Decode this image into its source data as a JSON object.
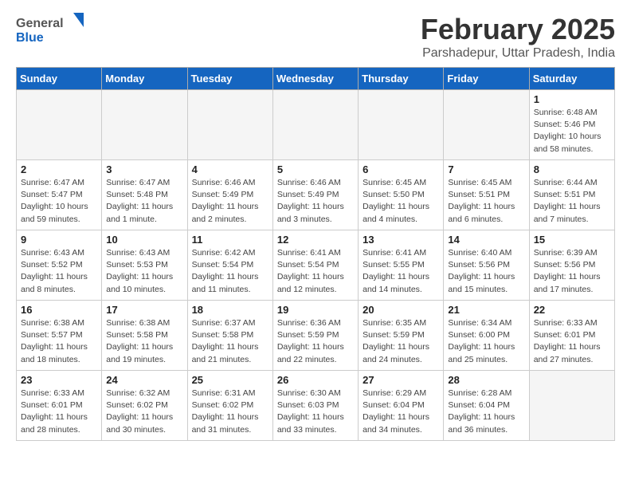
{
  "header": {
    "logo_general": "General",
    "logo_blue": "Blue",
    "title": "February 2025",
    "location": "Parshadepur, Uttar Pradesh, India"
  },
  "weekdays": [
    "Sunday",
    "Monday",
    "Tuesday",
    "Wednesday",
    "Thursday",
    "Friday",
    "Saturday"
  ],
  "weeks": [
    [
      {
        "day": "",
        "info": ""
      },
      {
        "day": "",
        "info": ""
      },
      {
        "day": "",
        "info": ""
      },
      {
        "day": "",
        "info": ""
      },
      {
        "day": "",
        "info": ""
      },
      {
        "day": "",
        "info": ""
      },
      {
        "day": "1",
        "info": "Sunrise: 6:48 AM\nSunset: 5:46 PM\nDaylight: 10 hours and 58 minutes."
      }
    ],
    [
      {
        "day": "2",
        "info": "Sunrise: 6:47 AM\nSunset: 5:47 PM\nDaylight: 10 hours and 59 minutes."
      },
      {
        "day": "3",
        "info": "Sunrise: 6:47 AM\nSunset: 5:48 PM\nDaylight: 11 hours and 1 minute."
      },
      {
        "day": "4",
        "info": "Sunrise: 6:46 AM\nSunset: 5:49 PM\nDaylight: 11 hours and 2 minutes."
      },
      {
        "day": "5",
        "info": "Sunrise: 6:46 AM\nSunset: 5:49 PM\nDaylight: 11 hours and 3 minutes."
      },
      {
        "day": "6",
        "info": "Sunrise: 6:45 AM\nSunset: 5:50 PM\nDaylight: 11 hours and 4 minutes."
      },
      {
        "day": "7",
        "info": "Sunrise: 6:45 AM\nSunset: 5:51 PM\nDaylight: 11 hours and 6 minutes."
      },
      {
        "day": "8",
        "info": "Sunrise: 6:44 AM\nSunset: 5:51 PM\nDaylight: 11 hours and 7 minutes."
      }
    ],
    [
      {
        "day": "9",
        "info": "Sunrise: 6:43 AM\nSunset: 5:52 PM\nDaylight: 11 hours and 8 minutes."
      },
      {
        "day": "10",
        "info": "Sunrise: 6:43 AM\nSunset: 5:53 PM\nDaylight: 11 hours and 10 minutes."
      },
      {
        "day": "11",
        "info": "Sunrise: 6:42 AM\nSunset: 5:54 PM\nDaylight: 11 hours and 11 minutes."
      },
      {
        "day": "12",
        "info": "Sunrise: 6:41 AM\nSunset: 5:54 PM\nDaylight: 11 hours and 12 minutes."
      },
      {
        "day": "13",
        "info": "Sunrise: 6:41 AM\nSunset: 5:55 PM\nDaylight: 11 hours and 14 minutes."
      },
      {
        "day": "14",
        "info": "Sunrise: 6:40 AM\nSunset: 5:56 PM\nDaylight: 11 hours and 15 minutes."
      },
      {
        "day": "15",
        "info": "Sunrise: 6:39 AM\nSunset: 5:56 PM\nDaylight: 11 hours and 17 minutes."
      }
    ],
    [
      {
        "day": "16",
        "info": "Sunrise: 6:38 AM\nSunset: 5:57 PM\nDaylight: 11 hours and 18 minutes."
      },
      {
        "day": "17",
        "info": "Sunrise: 6:38 AM\nSunset: 5:58 PM\nDaylight: 11 hours and 19 minutes."
      },
      {
        "day": "18",
        "info": "Sunrise: 6:37 AM\nSunset: 5:58 PM\nDaylight: 11 hours and 21 minutes."
      },
      {
        "day": "19",
        "info": "Sunrise: 6:36 AM\nSunset: 5:59 PM\nDaylight: 11 hours and 22 minutes."
      },
      {
        "day": "20",
        "info": "Sunrise: 6:35 AM\nSunset: 5:59 PM\nDaylight: 11 hours and 24 minutes."
      },
      {
        "day": "21",
        "info": "Sunrise: 6:34 AM\nSunset: 6:00 PM\nDaylight: 11 hours and 25 minutes."
      },
      {
        "day": "22",
        "info": "Sunrise: 6:33 AM\nSunset: 6:01 PM\nDaylight: 11 hours and 27 minutes."
      }
    ],
    [
      {
        "day": "23",
        "info": "Sunrise: 6:33 AM\nSunset: 6:01 PM\nDaylight: 11 hours and 28 minutes."
      },
      {
        "day": "24",
        "info": "Sunrise: 6:32 AM\nSunset: 6:02 PM\nDaylight: 11 hours and 30 minutes."
      },
      {
        "day": "25",
        "info": "Sunrise: 6:31 AM\nSunset: 6:02 PM\nDaylight: 11 hours and 31 minutes."
      },
      {
        "day": "26",
        "info": "Sunrise: 6:30 AM\nSunset: 6:03 PM\nDaylight: 11 hours and 33 minutes."
      },
      {
        "day": "27",
        "info": "Sunrise: 6:29 AM\nSunset: 6:04 PM\nDaylight: 11 hours and 34 minutes."
      },
      {
        "day": "28",
        "info": "Sunrise: 6:28 AM\nSunset: 6:04 PM\nDaylight: 11 hours and 36 minutes."
      },
      {
        "day": "",
        "info": ""
      }
    ]
  ]
}
